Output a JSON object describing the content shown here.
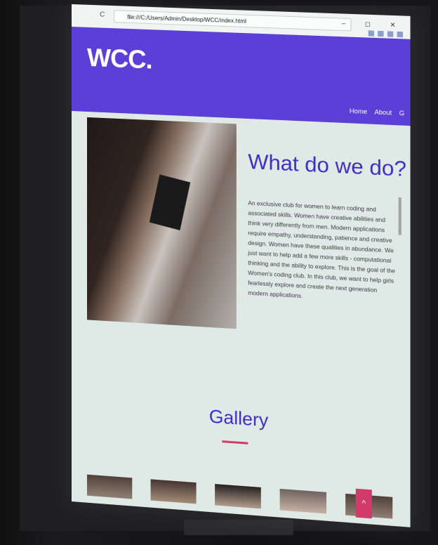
{
  "browser": {
    "url": "file:///C:/Users/Admin/Desktop/WCC/index.html",
    "window_controls": "–   ◻   ✕"
  },
  "site": {
    "logo": "WCC.",
    "nav": [
      "Home",
      "About",
      "G"
    ],
    "section_title": "What do we do?",
    "section_text": "An exclusive club for women to learn coding and associated skills. Women have creative abilities and think very differently from men. Modern applications require empathy, understanding, patience and creative design. Women have these qualities in abundance. We just want to help add a few more skills - computational thinking and the ability to explore. This is the goal of the Women's coding club. In this club, we want to help girls fearlessly explore and create the next generation modern applications.",
    "gallery_title": "Gallery",
    "scroll_top_icon": "^"
  },
  "colors": {
    "brand_purple": "#5b3fd6",
    "title_purple": "#3f2ec2",
    "accent_pink": "#d13a6a"
  }
}
